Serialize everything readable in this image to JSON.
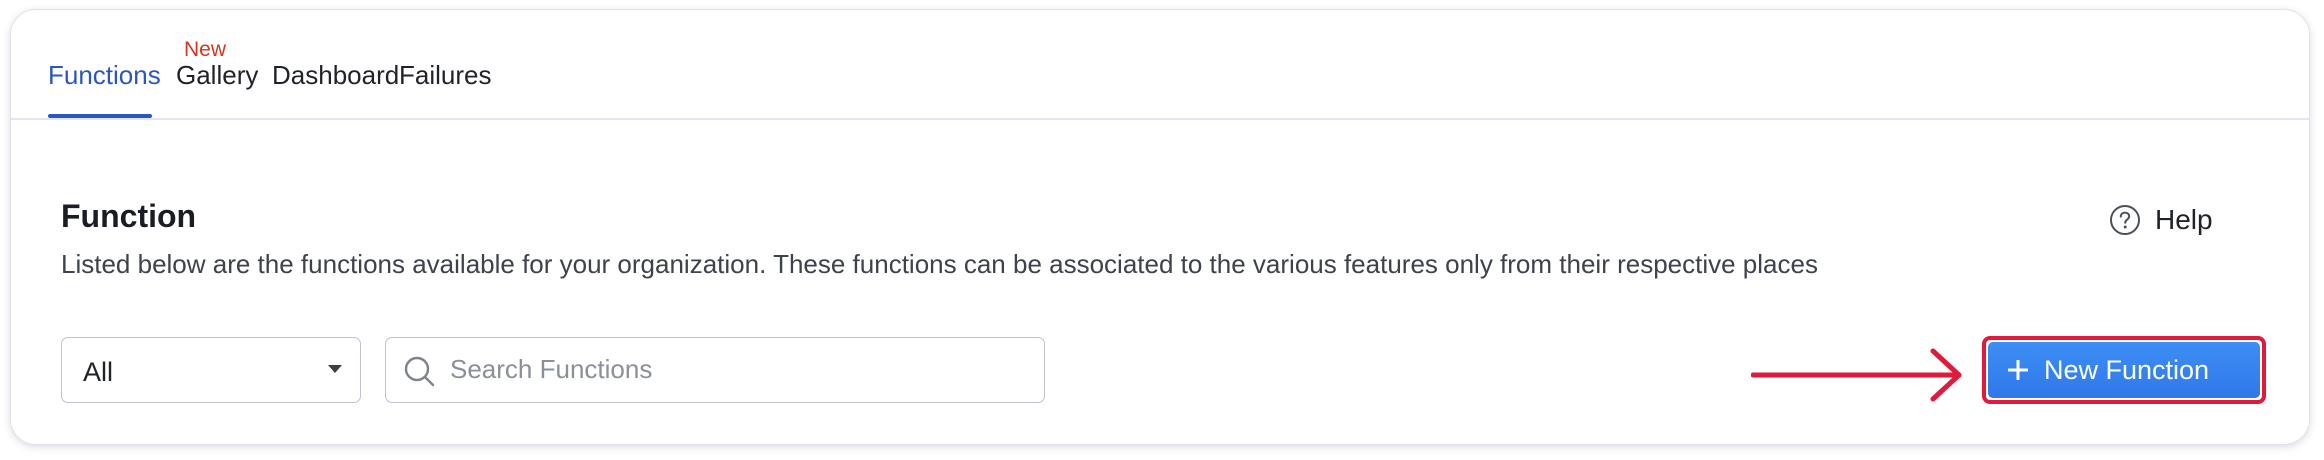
{
  "tabs": [
    {
      "label": "Functions",
      "active": true,
      "badge": "New"
    },
    {
      "label": "Gallery",
      "active": false
    },
    {
      "label": "Dashboard",
      "active": false
    },
    {
      "label": "Failures",
      "active": false
    }
  ],
  "page": {
    "title": "Function",
    "description": "Listed below are the functions available for your organization. These functions can be associated to the various features only from their respective places"
  },
  "help": {
    "label": "Help",
    "icon": "question-circle-icon"
  },
  "filter": {
    "selected": "All"
  },
  "search": {
    "placeholder": "Search Functions",
    "value": ""
  },
  "actions": {
    "new_function_label": "New Function",
    "icon": "plus-icon"
  },
  "colors": {
    "accent": "#2a56c0",
    "badge": "#d4361f",
    "primary_button": "#3584f0",
    "annotation": "#e01a3c"
  }
}
